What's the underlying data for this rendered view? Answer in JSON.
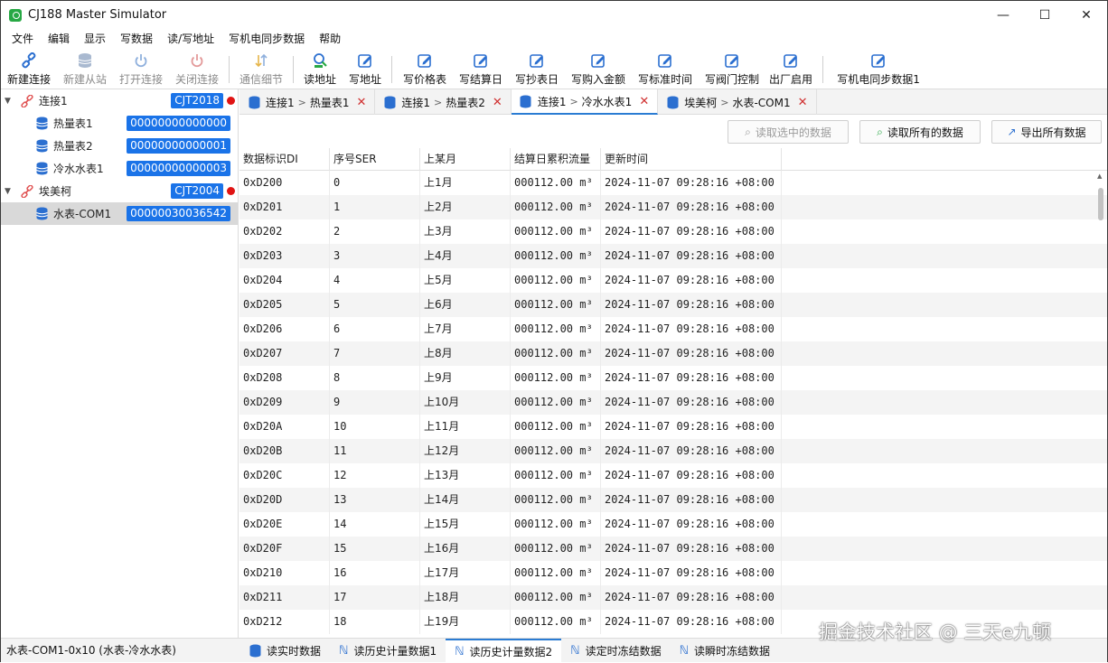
{
  "window": {
    "title": "CJ188 Master Simulator",
    "minimize": "—",
    "maximize": "☐",
    "close": "✕"
  },
  "menu": [
    "文件",
    "编辑",
    "显示",
    "写数据",
    "读/写地址",
    "写机电同步数据",
    "帮助"
  ],
  "toolbar": [
    {
      "label": "新建连接",
      "icon": "link-icon",
      "enabled": true
    },
    {
      "label": "新建从站",
      "icon": "database-icon",
      "enabled": false
    },
    {
      "label": "打开连接",
      "icon": "power-icon",
      "enabled": false
    },
    {
      "label": "关闭连接",
      "icon": "power-off-icon",
      "enabled": false
    },
    {
      "label": "通信细节",
      "icon": "sort-icon",
      "enabled": false
    },
    {
      "label": "读地址",
      "icon": "search-icon",
      "enabled": true
    },
    {
      "label": "写地址",
      "icon": "edit-icon",
      "enabled": true
    },
    {
      "label": "写价格表",
      "icon": "edit-icon",
      "enabled": true
    },
    {
      "label": "写结算日",
      "icon": "edit-icon",
      "enabled": true
    },
    {
      "label": "写抄表日",
      "icon": "edit-icon",
      "enabled": true
    },
    {
      "label": "写购入金额",
      "icon": "edit-icon",
      "enabled": true
    },
    {
      "label": "写标准时间",
      "icon": "edit-icon",
      "enabled": true
    },
    {
      "label": "写阀门控制",
      "icon": "edit-icon",
      "enabled": true
    },
    {
      "label": "出厂启用",
      "icon": "edit-icon",
      "enabled": true
    },
    {
      "label": "写机电同步数据1",
      "icon": "edit-icon",
      "enabled": true
    }
  ],
  "tree": [
    {
      "label": "连接1",
      "badge": "CJT2018",
      "level": 0,
      "dot": true
    },
    {
      "label": "热量表1",
      "badge": "00000000000000",
      "level": 1
    },
    {
      "label": "热量表2",
      "badge": "00000000000001",
      "level": 1
    },
    {
      "label": "冷水水表1",
      "badge": "00000000000003",
      "level": 1
    },
    {
      "label": "埃美柯",
      "badge": "CJT2004",
      "level": 0,
      "dot": true
    },
    {
      "label": "水表-COM1",
      "badge": "00000030036542",
      "level": 1,
      "selected": true
    }
  ],
  "tabs": [
    {
      "conn": "连接1",
      "name": "热量表1",
      "active": false
    },
    {
      "conn": "连接1",
      "name": "热量表2",
      "active": false
    },
    {
      "conn": "连接1",
      "name": "冷水水表1",
      "active": true
    },
    {
      "conn": "埃美柯",
      "name": "水表-COM1",
      "active": false
    }
  ],
  "actions": {
    "read_selected": "读取选中的数据",
    "read_all": "读取所有的数据",
    "export_all": "导出所有数据"
  },
  "table": {
    "headers": [
      "数据标识DI",
      "序号SER",
      "上某月",
      "结算日累积流量",
      "更新时间"
    ],
    "rows": [
      [
        "0xD200",
        "0",
        "上1月",
        "000112.00 m³",
        "2024-11-07 09:28:16 +08:00"
      ],
      [
        "0xD201",
        "1",
        "上2月",
        "000112.00 m³",
        "2024-11-07 09:28:16 +08:00"
      ],
      [
        "0xD202",
        "2",
        "上3月",
        "000112.00 m³",
        "2024-11-07 09:28:16 +08:00"
      ],
      [
        "0xD203",
        "3",
        "上4月",
        "000112.00 m³",
        "2024-11-07 09:28:16 +08:00"
      ],
      [
        "0xD204",
        "4",
        "上5月",
        "000112.00 m³",
        "2024-11-07 09:28:16 +08:00"
      ],
      [
        "0xD205",
        "5",
        "上6月",
        "000112.00 m³",
        "2024-11-07 09:28:16 +08:00"
      ],
      [
        "0xD206",
        "6",
        "上7月",
        "000112.00 m³",
        "2024-11-07 09:28:16 +08:00"
      ],
      [
        "0xD207",
        "7",
        "上8月",
        "000112.00 m³",
        "2024-11-07 09:28:16 +08:00"
      ],
      [
        "0xD208",
        "8",
        "上9月",
        "000112.00 m³",
        "2024-11-07 09:28:16 +08:00"
      ],
      [
        "0xD209",
        "9",
        "上10月",
        "000112.00 m³",
        "2024-11-07 09:28:16 +08:00"
      ],
      [
        "0xD20A",
        "10",
        "上11月",
        "000112.00 m³",
        "2024-11-07 09:28:16 +08:00"
      ],
      [
        "0xD20B",
        "11",
        "上12月",
        "000112.00 m³",
        "2024-11-07 09:28:16 +08:00"
      ],
      [
        "0xD20C",
        "12",
        "上13月",
        "000112.00 m³",
        "2024-11-07 09:28:16 +08:00"
      ],
      [
        "0xD20D",
        "13",
        "上14月",
        "000112.00 m³",
        "2024-11-07 09:28:16 +08:00"
      ],
      [
        "0xD20E",
        "14",
        "上15月",
        "000112.00 m³",
        "2024-11-07 09:28:16 +08:00"
      ],
      [
        "0xD20F",
        "15",
        "上16月",
        "000112.00 m³",
        "2024-11-07 09:28:16 +08:00"
      ],
      [
        "0xD210",
        "16",
        "上17月",
        "000112.00 m³",
        "2024-11-07 09:28:16 +08:00"
      ],
      [
        "0xD211",
        "17",
        "上18月",
        "000112.00 m³",
        "2024-11-07 09:28:16 +08:00"
      ],
      [
        "0xD212",
        "18",
        "上19月",
        "000112.00 m³",
        "2024-11-07 09:28:16 +08:00"
      ]
    ]
  },
  "status": "水表-COM1-0x10 (水表-冷水水表)",
  "bottom_tabs": [
    {
      "label": "读实时数据",
      "active": false
    },
    {
      "label": "读历史计量数据1",
      "active": false
    },
    {
      "label": "读历史计量数据2",
      "active": true
    },
    {
      "label": "读定时冻结数据",
      "active": false
    },
    {
      "label": "读瞬时冻结数据",
      "active": false
    }
  ],
  "watermark": "掘金技术社区 @ 三天e九顿",
  "colors": {
    "accent": "#2b7cd3",
    "badge": "#1a73e8",
    "dot": "#e01414",
    "connection_icon": "#e05050"
  }
}
